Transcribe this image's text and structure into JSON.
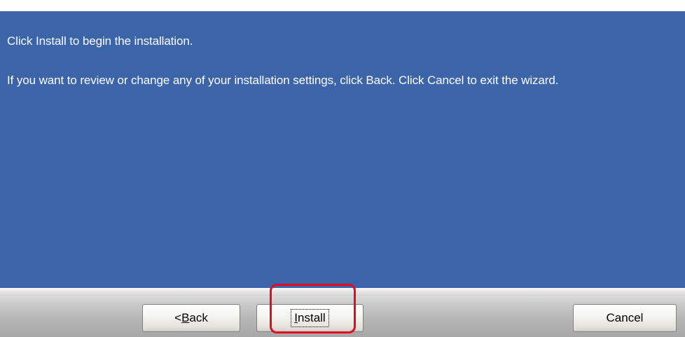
{
  "wizard": {
    "message_1": "Click Install to begin the installation.",
    "message_2": "If you want to review or change any of your installation settings, click Back. Click Cancel to exit the wizard."
  },
  "buttons": {
    "back": {
      "prefix": "< ",
      "mnemonic": "B",
      "rest": "ack"
    },
    "install": {
      "mnemonic": "I",
      "rest": "nstall"
    },
    "cancel": {
      "label": "Cancel"
    }
  },
  "colors": {
    "panel_blue": "#3c64a8",
    "highlight_red": "#e30b1e",
    "text_white": "#ffffff"
  }
}
